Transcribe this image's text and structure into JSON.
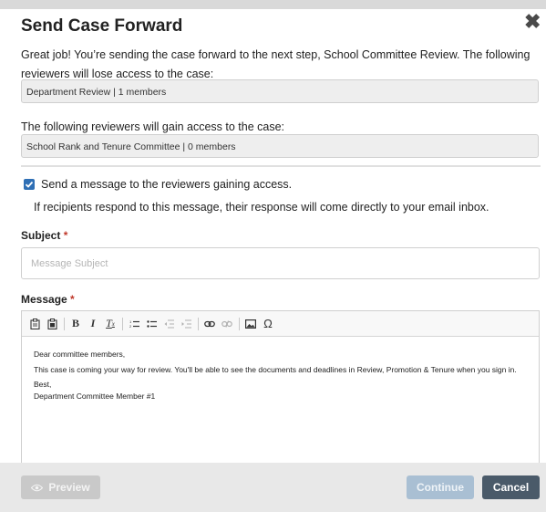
{
  "modal": {
    "title": "Send Case Forward",
    "close_symbol": "✖",
    "intro": "Great job! You’re sending the case forward to the next step, School Committee Review. The following reviewers will lose access to the case:",
    "losing_group": "Department Review | 1 members",
    "gain_label": "The following reviewers will gain access to the case:",
    "gaining_group": "School Rank and Tenure Committee | 0 members",
    "send_message": {
      "checked": true,
      "label": "Send a message to the reviewers gaining access.",
      "help": "If recipients respond to this message, their response will come directly to your email inbox."
    },
    "subject": {
      "label": "Subject",
      "required_mark": "*",
      "placeholder": "Message Subject",
      "value": ""
    },
    "message": {
      "label": "Message",
      "required_mark": "*",
      "toolbar": [
        "paste-icon",
        "paste-text-icon",
        "bold-icon",
        "italic-icon",
        "remove-format-icon",
        "numbered-list-icon",
        "bulleted-list-icon",
        "outdent-icon",
        "indent-icon",
        "link-icon",
        "unlink-icon",
        "image-icon",
        "special-char-icon"
      ],
      "greeting": "Dear committee members,",
      "body": "This case is coming your way for review. You'll be able to see the documents and deadlines in Review, Promotion & Tenure when you sign in.",
      "closing": "Best,",
      "signature": "Department Committee Member #1"
    }
  },
  "footer": {
    "preview_label": "Preview",
    "continue_label": "Continue",
    "cancel_label": "Cancel"
  },
  "colors": {
    "checkbox": "#2f6fb5",
    "cancel": "#4a5a69",
    "continue_disabled": "#a9bfd3",
    "preview_disabled": "#c9c9c9",
    "required": "#c0392b"
  }
}
